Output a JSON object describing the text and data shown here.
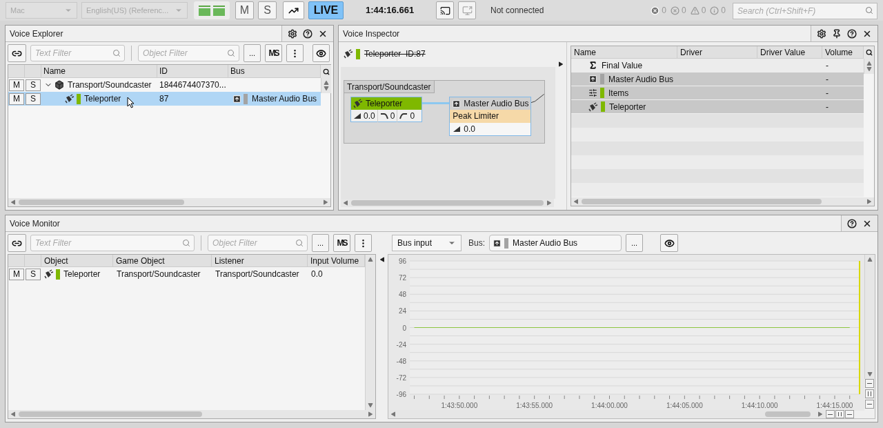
{
  "toolbar": {
    "platform": {
      "value": "Mac",
      "disabled": true
    },
    "language": {
      "value": "English(US) (Referenc...",
      "disabled": true
    },
    "mute_label": "M",
    "solo_label": "S",
    "live": {
      "label": "LIVE",
      "selected": true
    },
    "time": "1:44:16.661",
    "connection": "Not connected",
    "counts": [
      {
        "kind": "error",
        "value": "0"
      },
      {
        "kind": "error_outline",
        "value": "0"
      },
      {
        "kind": "warning",
        "value": "0"
      },
      {
        "kind": "info",
        "value": "0"
      }
    ],
    "search": {
      "placeholder": "Search (Ctrl+Shift+F)"
    }
  },
  "voice_explorer": {
    "title": "Voice Explorer",
    "text_filter": {
      "placeholder": "Text Filter"
    },
    "object_filter": {
      "placeholder": "Object Filter"
    },
    "more_label": "...",
    "ms_label": "MS",
    "columns": [
      "Name",
      "ID",
      "Bus"
    ],
    "rows": [
      {
        "mute": "M",
        "solo": "S",
        "kind": "game_object",
        "expanded": true,
        "name": "Transport/Soundcaster",
        "id": "1844674407370...",
        "selected": false,
        "children": [
          {
            "mute": "M",
            "solo": "S",
            "kind": "sound",
            "color": "#7fb800",
            "name": "Teleporter",
            "id": "87",
            "bus": {
              "name": "Master Audio Bus",
              "color": "#a3a3a3"
            },
            "selected": true
          }
        ]
      }
    ]
  },
  "voice_inspector": {
    "title": "Voice Inspector",
    "header": {
      "name": "Teleporter  ID:87",
      "color": "#7fb800",
      "struck": true
    },
    "graph": {
      "group": "Transport/Soundcaster",
      "source": {
        "name": "Teleporter",
        "values": [
          "0.0",
          "0",
          "0"
        ]
      },
      "bus": {
        "name": "Master Audio Bus",
        "effect": "Peak Limiter",
        "value": "0.0"
      }
    },
    "columns": [
      "Name",
      "Driver",
      "Driver Value",
      "Volume"
    ],
    "rows": [
      {
        "kind": "sum",
        "name": "Final Value",
        "volume": "-",
        "shaded": false
      },
      {
        "kind": "bus",
        "color": "#a3a3a3",
        "name": "Master Audio Bus",
        "volume": "-",
        "shaded": true
      },
      {
        "kind": "items",
        "color": "#7fb800",
        "name": "Items",
        "volume": "-",
        "shaded": true
      },
      {
        "kind": "sound",
        "color": "#7fb800",
        "name": "Teleporter",
        "volume": "-",
        "shaded": true
      }
    ]
  },
  "voice_monitor": {
    "title": "Voice Monitor",
    "text_filter": {
      "placeholder": "Text Filter"
    },
    "object_filter": {
      "placeholder": "Object Filter"
    },
    "more_label": "...",
    "ms_label": "MS",
    "mode": "Bus input",
    "bus_label": "Bus:",
    "bus": {
      "name": "Master Audio Bus",
      "color": "#a3a3a3"
    },
    "bus_more_label": "...",
    "columns": [
      "Object",
      "Game Object",
      "Listener",
      "Input Volume"
    ],
    "rows": [
      {
        "mute": "M",
        "solo": "S",
        "name": "Teleporter",
        "color": "#7fb800",
        "game_object": "Transport/Soundcaster",
        "listener": "Transport/Soundcaster",
        "input_volume": "0.0"
      }
    ],
    "chart_data": {
      "type": "line",
      "categories": [
        null,
        null,
        null,
        "1:43:50.000",
        null,
        null,
        null,
        null,
        "1:43:55.000",
        null,
        null,
        null,
        null,
        "1:44:00.000",
        null,
        null,
        null,
        null,
        "1:44:05.000",
        null,
        null,
        null,
        null,
        "1:44:10.000",
        null,
        null,
        null,
        null,
        "1:44:15.000",
        null
      ],
      "series": [
        {
          "color": "#8cc63f",
          "values": [
            0,
            0,
            0,
            0,
            0,
            0,
            0,
            0,
            0,
            0,
            0,
            0,
            0,
            0,
            0,
            0,
            0,
            0,
            0,
            0,
            0,
            0,
            0,
            0,
            0,
            0,
            0,
            0,
            0,
            0
          ]
        }
      ],
      "ylim": [
        -96,
        96
      ],
      "grid": true,
      "yticks": [
        96,
        72,
        48,
        24,
        0,
        -24,
        -48,
        -72,
        -96
      ]
    }
  }
}
